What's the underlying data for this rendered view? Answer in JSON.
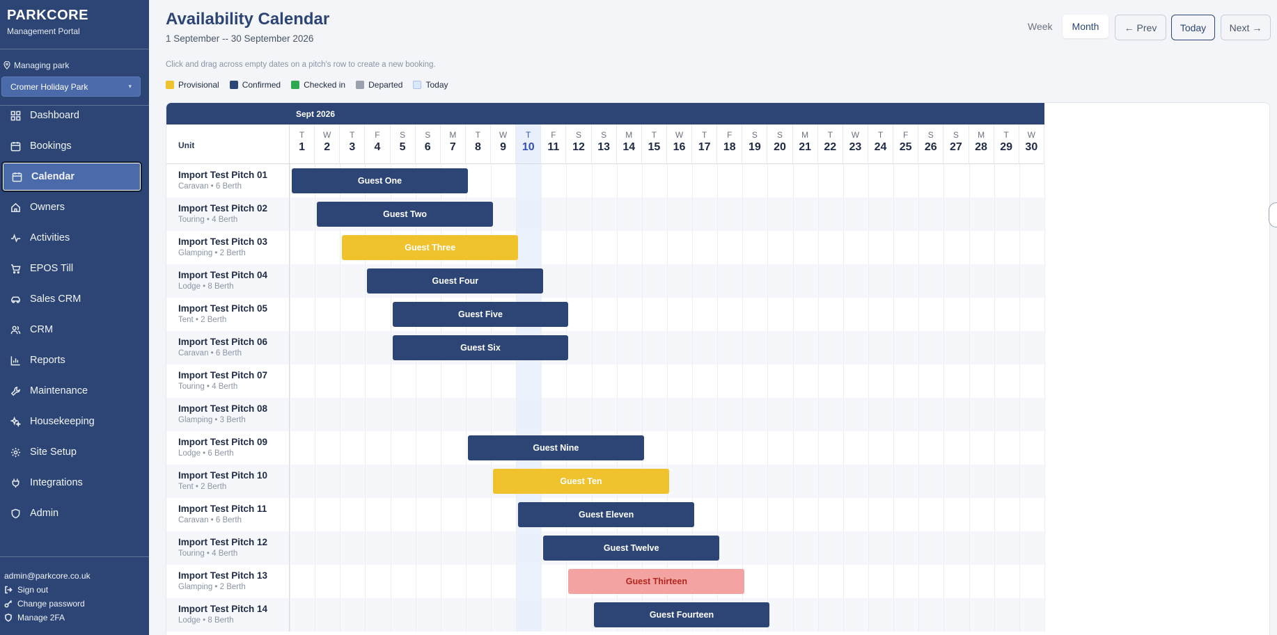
{
  "app": {
    "name": "PARKCORE",
    "subtitle": "Management Portal"
  },
  "park": {
    "label": "Managing park",
    "selected": "Cromer Holiday Park"
  },
  "nav": [
    {
      "label": "Dashboard",
      "icon": "grid-icon",
      "active": false
    },
    {
      "label": "Bookings",
      "icon": "calendar-icon",
      "active": false
    },
    {
      "label": "Calendar",
      "icon": "calendar-icon",
      "active": true
    },
    {
      "label": "Owners",
      "icon": "home-icon",
      "active": false
    },
    {
      "label": "Activities",
      "icon": "activity-icon",
      "active": false
    },
    {
      "label": "EPOS Till",
      "icon": "cart-icon",
      "active": false
    },
    {
      "label": "Sales CRM",
      "icon": "car-icon",
      "active": false
    },
    {
      "label": "CRM",
      "icon": "users-icon",
      "active": false
    },
    {
      "label": "Reports",
      "icon": "chart-icon",
      "active": false
    },
    {
      "label": "Maintenance",
      "icon": "wrench-icon",
      "active": false
    },
    {
      "label": "Housekeeping",
      "icon": "sparkle-icon",
      "active": false
    },
    {
      "label": "Site Setup",
      "icon": "gear-icon",
      "active": false
    },
    {
      "label": "Integrations",
      "icon": "plug-icon",
      "active": false
    },
    {
      "label": "Admin",
      "icon": "shield-icon",
      "active": false
    }
  ],
  "user": {
    "email": "admin@parkcore.co.uk",
    "sign_out": "Sign out",
    "change_password": "Change password",
    "manage_2fa": "Manage 2FA"
  },
  "header": {
    "title": "Availability Calendar",
    "range": "1 September -- 30 September 2026",
    "hint": "Click and drag across empty dates on a pitch's row to create a new booking."
  },
  "view": {
    "week": "Week",
    "month": "Month",
    "selected": "Month"
  },
  "controls": {
    "prev": "← Prev",
    "today": "Today",
    "next": "Next →"
  },
  "legend": [
    {
      "label": "Provisional",
      "color": "#f0c22e"
    },
    {
      "label": "Confirmed",
      "color": "#2d4575"
    },
    {
      "label": "Checked in",
      "color": "#2fa84f"
    },
    {
      "label": "Departed",
      "color": "#9aa1ad"
    },
    {
      "label": "Today",
      "color": "#dbe8fb"
    }
  ],
  "calendar": {
    "month_label": "Sept 2026",
    "unit_header": "Unit",
    "today_day": 10,
    "days": [
      {
        "d": "T",
        "n": "1"
      },
      {
        "d": "W",
        "n": "2"
      },
      {
        "d": "T",
        "n": "3"
      },
      {
        "d": "F",
        "n": "4"
      },
      {
        "d": "S",
        "n": "5"
      },
      {
        "d": "S",
        "n": "6"
      },
      {
        "d": "M",
        "n": "7"
      },
      {
        "d": "T",
        "n": "8"
      },
      {
        "d": "W",
        "n": "9"
      },
      {
        "d": "T",
        "n": "10"
      },
      {
        "d": "F",
        "n": "11"
      },
      {
        "d": "S",
        "n": "12"
      },
      {
        "d": "S",
        "n": "13"
      },
      {
        "d": "M",
        "n": "14"
      },
      {
        "d": "T",
        "n": "15"
      },
      {
        "d": "W",
        "n": "16"
      },
      {
        "d": "T",
        "n": "17"
      },
      {
        "d": "F",
        "n": "18"
      },
      {
        "d": "S",
        "n": "19"
      },
      {
        "d": "S",
        "n": "20"
      },
      {
        "d": "M",
        "n": "21"
      },
      {
        "d": "T",
        "n": "22"
      },
      {
        "d": "W",
        "n": "23"
      },
      {
        "d": "T",
        "n": "24"
      },
      {
        "d": "F",
        "n": "25"
      },
      {
        "d": "S",
        "n": "26"
      },
      {
        "d": "S",
        "n": "27"
      },
      {
        "d": "M",
        "n": "28"
      },
      {
        "d": "T",
        "n": "29"
      },
      {
        "d": "W",
        "n": "30"
      }
    ],
    "units": [
      {
        "name": "Import Test Pitch 01",
        "meta": "Caravan • 6 Berth"
      },
      {
        "name": "Import Test Pitch 02",
        "meta": "Touring • 4 Berth"
      },
      {
        "name": "Import Test Pitch 03",
        "meta": "Glamping • 2 Berth"
      },
      {
        "name": "Import Test Pitch 04",
        "meta": "Lodge • 8 Berth"
      },
      {
        "name": "Import Test Pitch 05",
        "meta": "Tent • 2 Berth"
      },
      {
        "name": "Import Test Pitch 06",
        "meta": "Caravan • 6 Berth"
      },
      {
        "name": "Import Test Pitch 07",
        "meta": "Touring • 4 Berth"
      },
      {
        "name": "Import Test Pitch 08",
        "meta": "Glamping • 3 Berth"
      },
      {
        "name": "Import Test Pitch 09",
        "meta": "Lodge • 6 Berth"
      },
      {
        "name": "Import Test Pitch 10",
        "meta": "Tent • 2 Berth"
      },
      {
        "name": "Import Test Pitch 11",
        "meta": "Caravan • 6 Berth"
      },
      {
        "name": "Import Test Pitch 12",
        "meta": "Touring • 4 Berth"
      },
      {
        "name": "Import Test Pitch 13",
        "meta": "Glamping • 2 Berth"
      },
      {
        "name": "Import Test Pitch 14",
        "meta": "Lodge • 8 Berth"
      }
    ],
    "bookings": [
      {
        "unit": 0,
        "start": 1,
        "end": 8,
        "guest": "Guest One",
        "status": "confirmed"
      },
      {
        "unit": 1,
        "start": 2,
        "end": 9,
        "guest": "Guest Two",
        "status": "confirmed"
      },
      {
        "unit": 2,
        "start": 3,
        "end": 10,
        "guest": "Guest Three",
        "status": "provisional"
      },
      {
        "unit": 3,
        "start": 4,
        "end": 11,
        "guest": "Guest Four",
        "status": "confirmed"
      },
      {
        "unit": 4,
        "start": 5,
        "end": 12,
        "guest": "Guest Five",
        "status": "confirmed"
      },
      {
        "unit": 5,
        "start": 5,
        "end": 12,
        "guest": "Guest Six",
        "status": "confirmed"
      },
      {
        "unit": 8,
        "start": 8,
        "end": 15,
        "guest": "Guest Nine",
        "status": "confirmed"
      },
      {
        "unit": 9,
        "start": 9,
        "end": 16,
        "guest": "Guest Ten",
        "status": "provisional"
      },
      {
        "unit": 10,
        "start": 10,
        "end": 17,
        "guest": "Guest Eleven",
        "status": "confirmed"
      },
      {
        "unit": 11,
        "start": 11,
        "end": 18,
        "guest": "Guest Twelve",
        "status": "confirmed"
      },
      {
        "unit": 12,
        "start": 12,
        "end": 19,
        "guest": "Guest Thirteen",
        "status": "cancelled"
      },
      {
        "unit": 13,
        "start": 13,
        "end": 20,
        "guest": "Guest Fourteen",
        "status": "confirmed"
      }
    ],
    "status_colors": {
      "confirmed": {
        "bg": "#2d4575",
        "fg": "#ffffff"
      },
      "provisional": {
        "bg": "#f0c22e",
        "fg": "#ffffff"
      },
      "cancelled": {
        "bg": "#f4a3a3",
        "fg": "#b3261e"
      }
    }
  }
}
